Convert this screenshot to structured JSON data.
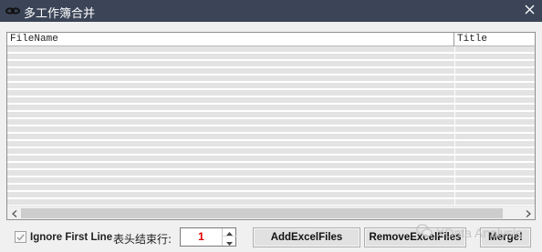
{
  "window": {
    "title": "多工作簿合并",
    "icon": "link-chain-icon"
  },
  "listview": {
    "columns": [
      "FileName",
      "Title"
    ],
    "row_count": 22
  },
  "controls": {
    "ignore_first_line_label": "Ignore First Line",
    "ignore_first_line_checked": true,
    "header_end_row_label": "表头结束行:",
    "header_end_row_value": "1",
    "add_button_label": "AddExcelFiles",
    "remove_button_label": "RemoveExcelFiles",
    "merge_button_label": "Merge!"
  },
  "watermark": {
    "text": "XData Analysis",
    "icon": "wechat-icon"
  },
  "colors": {
    "titlebar": "#3b4557",
    "row_fill": "#e3e3e3",
    "spin_value": "#e00000"
  }
}
